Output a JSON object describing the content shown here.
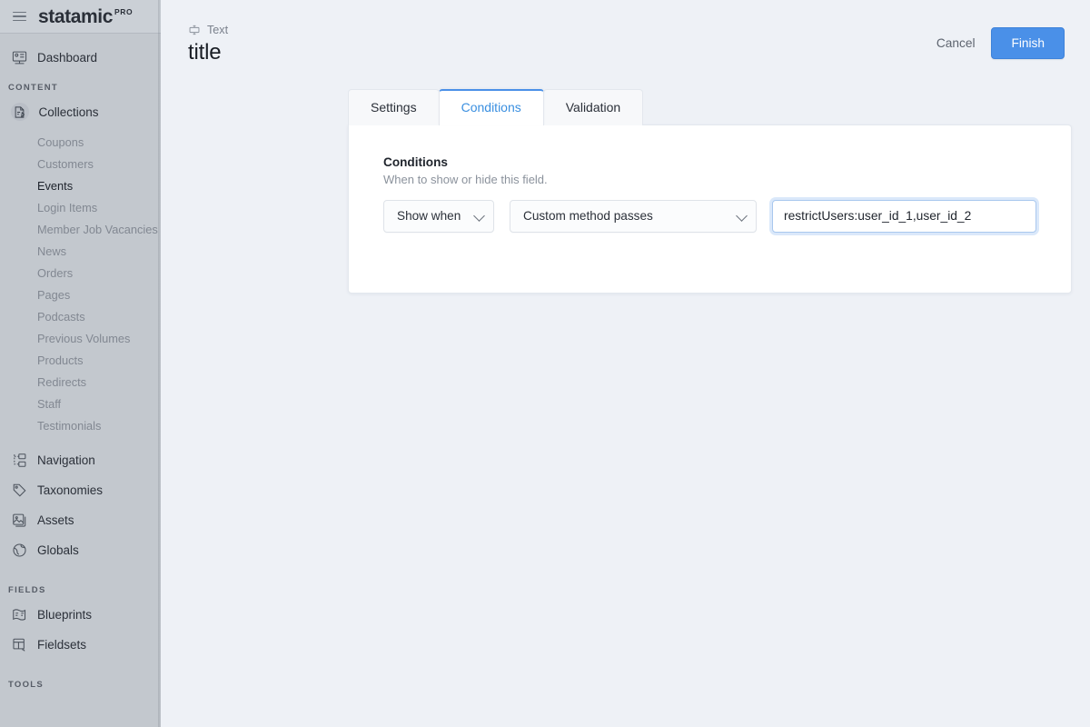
{
  "brand": {
    "name": "statamic",
    "badge": "PRO",
    "menu_icon": "hamburger-icon"
  },
  "sidebar": {
    "top_items": [
      {
        "label": "Dashboard",
        "icon": "dashboard-icon"
      }
    ],
    "sections": [
      {
        "title": "CONTENT",
        "items": [
          {
            "label": "Collections",
            "icon": "collections-icon",
            "active": true,
            "children": [
              {
                "label": "Coupons",
                "active": false
              },
              {
                "label": "Customers",
                "active": false
              },
              {
                "label": "Events",
                "active": true
              },
              {
                "label": "Login Items",
                "active": false
              },
              {
                "label": "Member Job Vacancies",
                "active": false
              },
              {
                "label": "News",
                "active": false
              },
              {
                "label": "Orders",
                "active": false
              },
              {
                "label": "Pages",
                "active": false
              },
              {
                "label": "Podcasts",
                "active": false
              },
              {
                "label": "Previous Volumes",
                "active": false
              },
              {
                "label": "Products",
                "active": false
              },
              {
                "label": "Redirects",
                "active": false
              },
              {
                "label": "Staff",
                "active": false
              },
              {
                "label": "Testimonials",
                "active": false
              }
            ]
          },
          {
            "label": "Navigation",
            "icon": "navigation-icon"
          },
          {
            "label": "Taxonomies",
            "icon": "tag-icon"
          },
          {
            "label": "Assets",
            "icon": "image-icon"
          },
          {
            "label": "Globals",
            "icon": "globe-icon"
          }
        ]
      },
      {
        "title": "FIELDS",
        "items": [
          {
            "label": "Blueprints",
            "icon": "blueprint-icon"
          },
          {
            "label": "Fieldsets",
            "icon": "fieldset-icon"
          }
        ]
      },
      {
        "title": "TOOLS",
        "items": []
      }
    ]
  },
  "header": {
    "kicker_icon": "text-field-icon",
    "kicker": "Text",
    "title": "title",
    "cancel_label": "Cancel",
    "finish_label": "Finish"
  },
  "tabs": [
    {
      "label": "Settings",
      "active": false
    },
    {
      "label": "Conditions",
      "active": true
    },
    {
      "label": "Validation",
      "active": false
    }
  ],
  "panel": {
    "field_label": "Conditions",
    "field_help": "When to show or hide this field.",
    "condition_mode": "Show when",
    "condition_operator": "Custom method passes",
    "condition_value": "restrictUsers:user_id_1,user_id_2",
    "condition_value_placeholder": ""
  },
  "colors": {
    "accent": "#4a90e8",
    "sidebar_bg": "#c3c8ce",
    "page_bg": "#eef1f6",
    "panel_bg": "#ffffff",
    "tab_active_text": "#3a8fe0",
    "focus_ring": "#a9c8ee"
  }
}
